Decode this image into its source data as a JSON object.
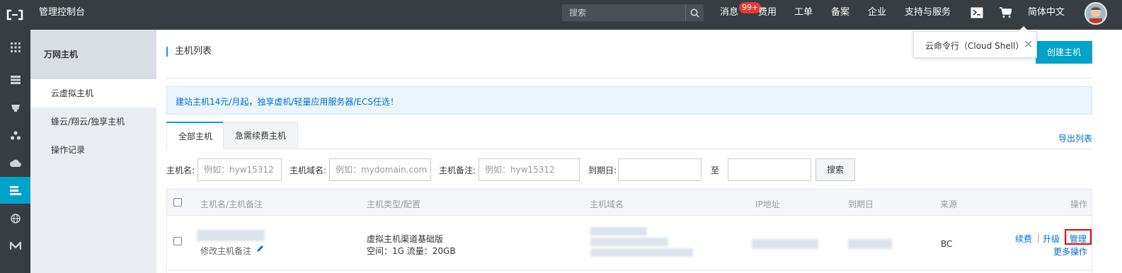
{
  "topbar": {
    "title": "管理控制台",
    "search_placeholder": "搜索",
    "nav": {
      "messages": "消息",
      "badge": "99+",
      "billing": "费用",
      "tickets": "工单",
      "icp": "备案",
      "enterprise": "企业",
      "support": "支持与服务",
      "language": "简体中文"
    }
  },
  "subnav": {
    "header": "万网主机",
    "items": [
      "云虚拟主机",
      "蜂云/翔云/独享主机",
      "操作记录"
    ]
  },
  "main": {
    "page_title": "主机列表",
    "create_button": "创建主机",
    "popover_text": "云命令行（Cloud Shell）",
    "popover_close": "✕",
    "notice": "建站主机14元/月起，独享虚机/轻量应用服务器/ECS任选！",
    "tabs": [
      "全部主机",
      "急需续费主机"
    ],
    "export": "导出列表",
    "filter": {
      "host_label": "主机名:",
      "host_placeholder": "例如：hyw15312",
      "domain_label": "主机域名:",
      "domain_placeholder": "例如：mydomain.com",
      "note_label": "主机备注:",
      "note_placeholder": "例如：hyw15312",
      "expire_label": "到期日:",
      "to": "至",
      "search_button": "搜索"
    },
    "table": {
      "headers": [
        "主机名/主机备注",
        "主机类型/配置",
        "主机域名",
        "IP地址",
        "到期日",
        "来源",
        "操作"
      ],
      "row": {
        "edit_note": "修改主机备注",
        "type": "虚拟主机渠道基础版",
        "config": "空间：1G 流量：20GB",
        "source": "BC",
        "renew": "续费",
        "separator": "|",
        "upgrade": "升级",
        "manage": "管理",
        "more": "更多操作"
      }
    }
  },
  "colors": {
    "topbar": "#373d41",
    "accent": "#00a2ca",
    "link": "#0070cc",
    "highlight_box": "#ee0000"
  }
}
